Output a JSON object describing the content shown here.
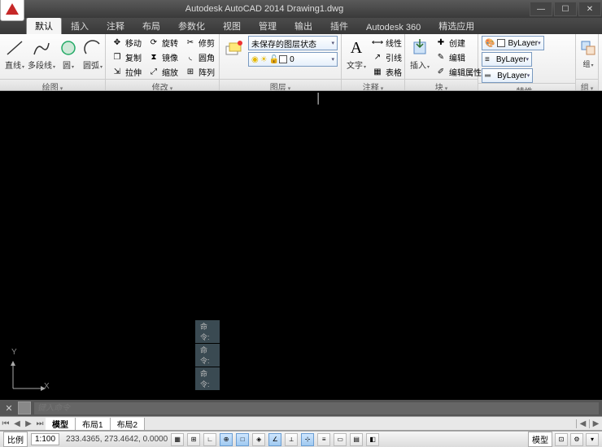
{
  "title": "Autodesk AutoCAD 2014    Drawing1.dwg",
  "tabs": [
    "默认",
    "插入",
    "注释",
    "布局",
    "参数化",
    "视图",
    "管理",
    "输出",
    "插件",
    "Autodesk 360",
    "精选应用"
  ],
  "active_tab": 0,
  "ribbon": {
    "draw": {
      "title": "绘图",
      "line": "直线",
      "polyline": "多段线",
      "circle": "圆",
      "arc": "圆弧"
    },
    "modify": {
      "title": "修改",
      "move": "移动",
      "rotate": "旋转",
      "trim": "修剪",
      "copy": "复制",
      "mirror": "镜像",
      "fillet": "圆角",
      "stretch": "拉伸",
      "scale": "缩放",
      "array": "阵列"
    },
    "layer": {
      "title": "图层",
      "unsaved": "未保存的图层状态",
      "current": "0"
    },
    "annotate": {
      "title": "注释",
      "text": "文字",
      "linear": "线性",
      "leader": "引线",
      "table": "表格"
    },
    "block": {
      "title": "块",
      "insert": "插入",
      "create": "创建",
      "edit": "编辑",
      "editattr": "编辑属性"
    },
    "properties": {
      "title": "特性",
      "bylayer": "ByLayer"
    },
    "group": {
      "title": "组",
      "label": "组"
    }
  },
  "cmd": {
    "echo": "命令:",
    "placeholder": "键入命令"
  },
  "layout_tabs": {
    "model": "模型",
    "l1": "布局1",
    "l2": "布局2"
  },
  "status": {
    "scale_label": "比例",
    "scale": "1:100",
    "coords": "233.4365, 273.4642, 0.0000",
    "model": "模型"
  }
}
